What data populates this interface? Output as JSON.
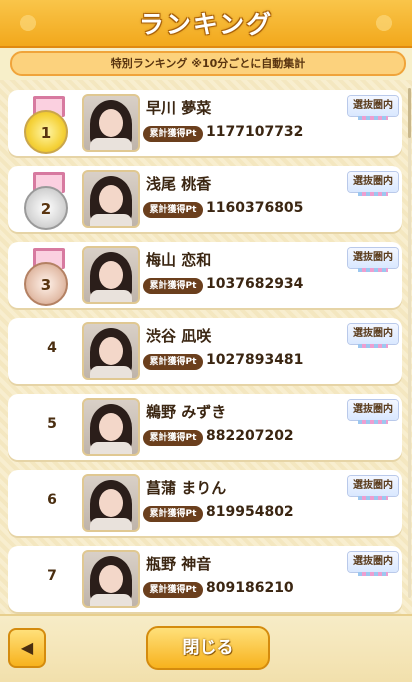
{
  "header": {
    "title": "ランキング"
  },
  "subtitle": "特別ランキング ※10分ごとに自動集計",
  "pt_label": "累計獲得Pt",
  "badge_label": "選抜圏内",
  "entries": [
    {
      "rank": "1",
      "medal": "gold",
      "name": "早川 夢菜",
      "points": "1177107732"
    },
    {
      "rank": "2",
      "medal": "silver",
      "name": "浅尾 桃香",
      "points": "1160376805"
    },
    {
      "rank": "3",
      "medal": "bronze",
      "name": "梅山 恋和",
      "points": "1037682934"
    },
    {
      "rank": "4",
      "medal": "",
      "name": "渋谷 凪咲",
      "points": "1027893481"
    },
    {
      "rank": "5",
      "medal": "",
      "name": "鵜野 みずき",
      "points": "882207202"
    },
    {
      "rank": "6",
      "medal": "",
      "name": "菖蒲 まりん",
      "points": "819954802"
    },
    {
      "rank": "7",
      "medal": "",
      "name": "瓶野 神音",
      "points": "809186210"
    }
  ],
  "footer": {
    "back_icon": "◀",
    "close_label": "閉じる"
  }
}
